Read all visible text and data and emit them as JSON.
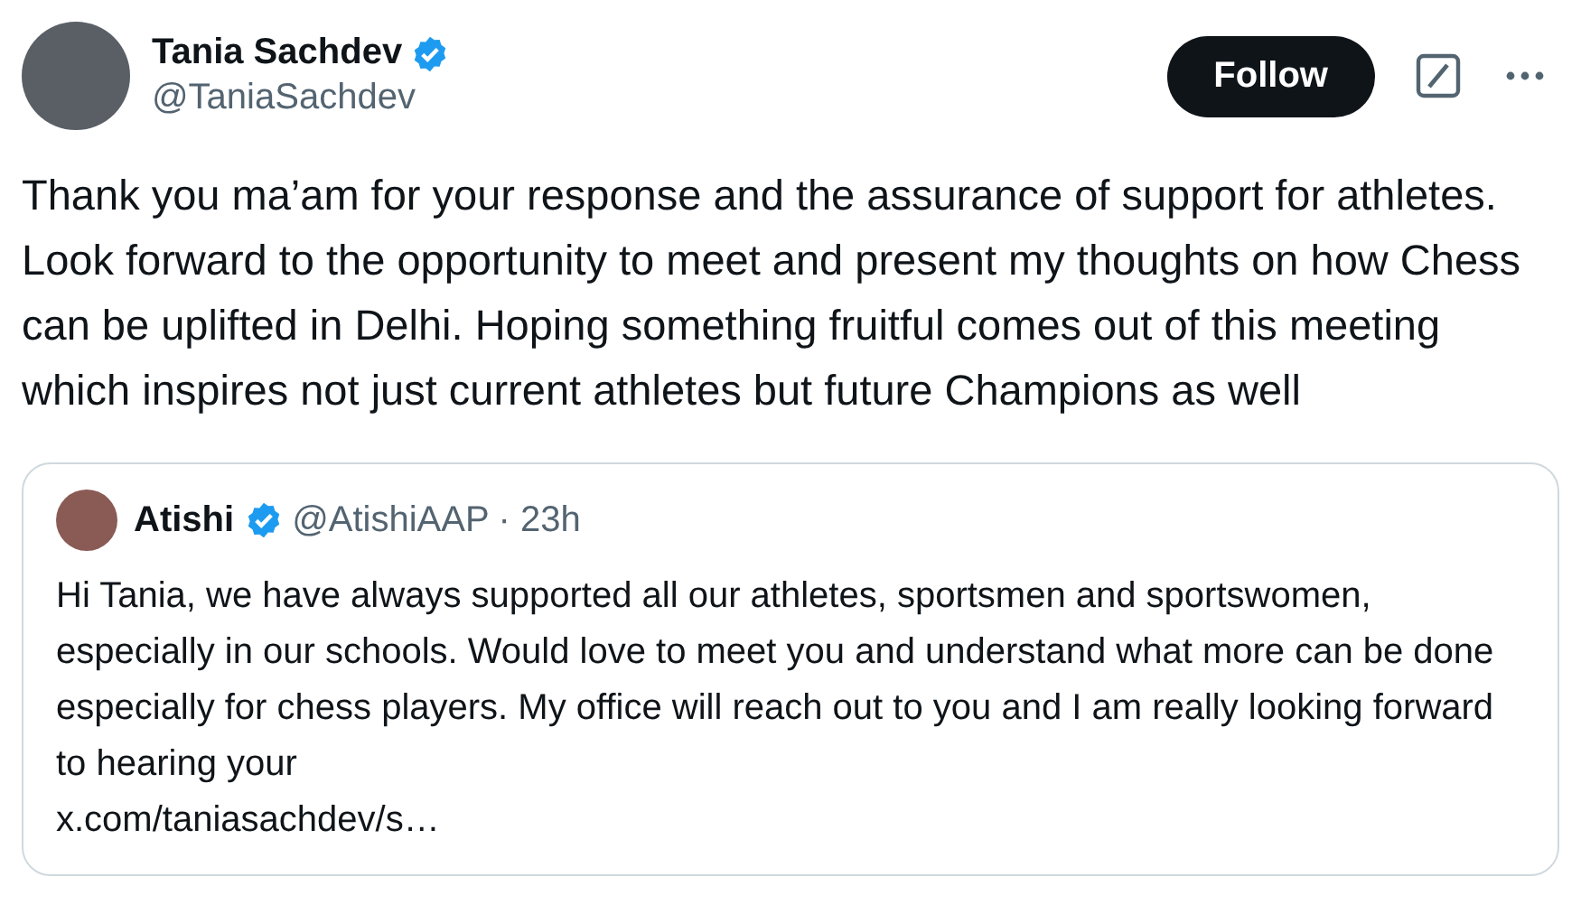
{
  "author": {
    "name": "Tania Sachdev",
    "verified": true,
    "handle": "@TaniaSachdev"
  },
  "follow_button": "Follow",
  "text": "Thank you ma’am for your response and the assurance of support for athletes. Look forward to the opportunity to meet and present my thoughts on how Chess can be uplifted in Delhi. Hoping something fruitful comes out of this meeting which inspires not just current athletes but future Champions as well",
  "quoted": {
    "name": "Atishi",
    "verified": true,
    "handle": "@AtishiAAP",
    "time": "· 23h",
    "text": "Hi Tania, we have always supported all our athletes, sportsmen and sportswomen, especially in our schools. Would love to meet you and understand what more can be done especially for chess players. My office will reach out to you and I am really looking forward to hearing your",
    "link": "x.com/taniasachdev/s…"
  }
}
